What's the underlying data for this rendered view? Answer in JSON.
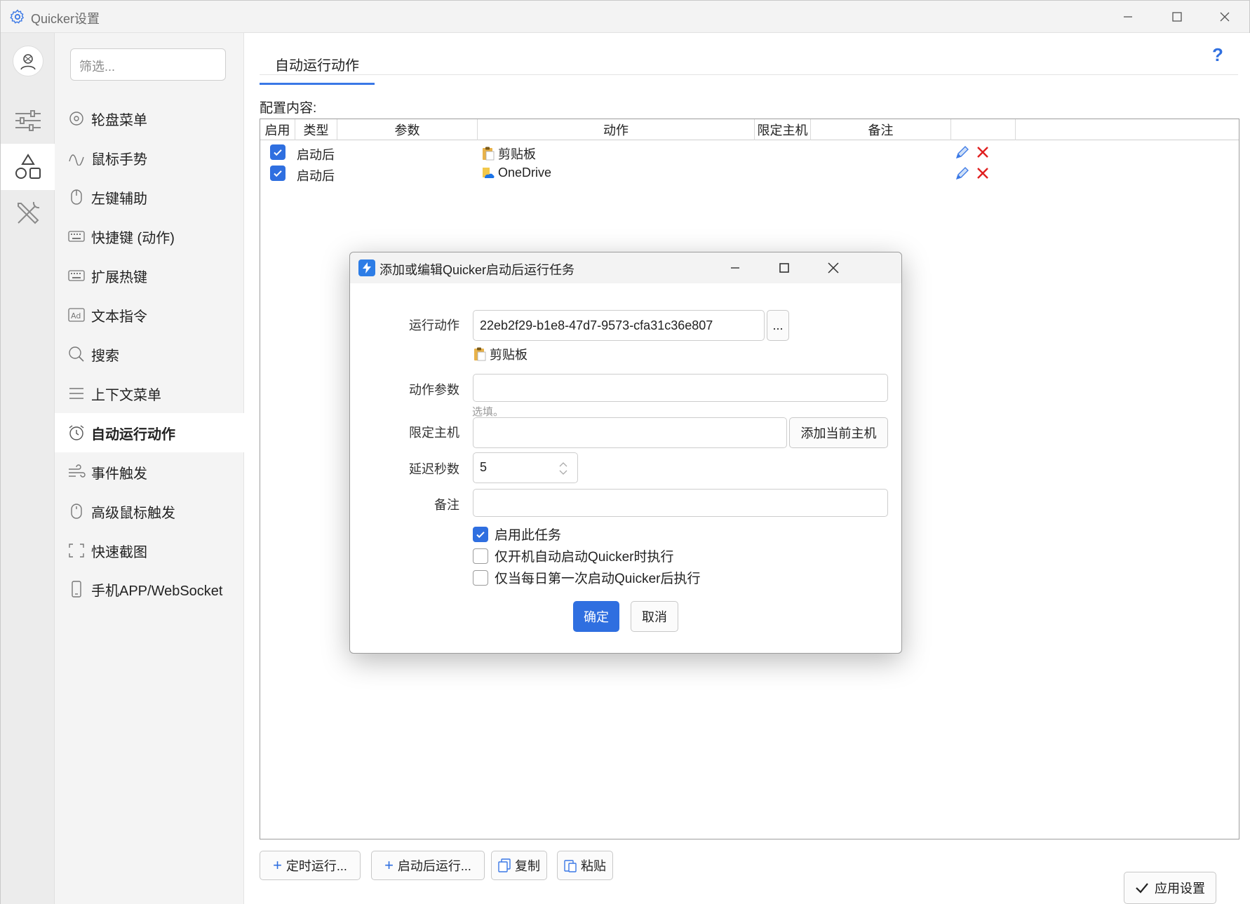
{
  "window": {
    "title": "Quicker设置",
    "controls": [
      "minimize",
      "maximize",
      "close"
    ]
  },
  "rail": {
    "icons": [
      "avatar",
      "sliders-icon",
      "shapes-icon",
      "tools-icon"
    ],
    "active": "shapes-icon"
  },
  "nav": {
    "filter_placeholder": "筛选...",
    "items": [
      {
        "label": "轮盘菜单",
        "icon": "wheel-icon"
      },
      {
        "label": "鼠标手势",
        "icon": "gesture-icon"
      },
      {
        "label": "左键辅助",
        "icon": "mouse-icon"
      },
      {
        "label": "快捷键 (动作)",
        "icon": "keyboard-icon"
      },
      {
        "label": "扩展热键",
        "icon": "keyboard-icon"
      },
      {
        "label": "文本指令",
        "icon": "ad-icon"
      },
      {
        "label": "搜索",
        "icon": "search-icon"
      },
      {
        "label": "上下文菜单",
        "icon": "menu-icon"
      },
      {
        "label": "自动运行动作",
        "icon": "alarm-icon"
      },
      {
        "label": "事件触发",
        "icon": "wind-icon"
      },
      {
        "label": "高级鼠标触发",
        "icon": "mouse-icon"
      },
      {
        "label": "快速截图",
        "icon": "screenshot-icon"
      },
      {
        "label": "手机APP/WebSocket",
        "icon": "phone-icon"
      }
    ],
    "active_index": 8
  },
  "main": {
    "tab": "自动运行动作",
    "help": "?",
    "config_label": "配置内容:",
    "columns": [
      "启用",
      "类型",
      "参数",
      "动作",
      "限定主机",
      "备注"
    ],
    "rows": [
      {
        "enabled": true,
        "type": "启动后",
        "param": "",
        "action": "剪贴板",
        "action_icon": "clipboard-icon",
        "host": "",
        "note": ""
      },
      {
        "enabled": true,
        "type": "启动后",
        "param": "",
        "action": "OneDrive",
        "action_icon": "onedrive-icon",
        "host": "",
        "note": ""
      }
    ],
    "buttons": {
      "timed": "定时运行...",
      "after_start": "启动后运行...",
      "copy": "复制",
      "paste": "粘贴",
      "apply": "应用设置"
    }
  },
  "dialog": {
    "title": "添加或编辑Quicker启动后运行任务",
    "run_action_label": "运行动作",
    "run_action_value": "22eb2f29-b1e8-47d7-9573-cfa31c36e807",
    "browse_label": "...",
    "action_name": "剪贴板",
    "action_params_label": "动作参数",
    "action_params_value": "",
    "optional_hint": "选填。",
    "host_label": "限定主机",
    "host_value": "",
    "add_host_label": "添加当前主机",
    "delay_label": "延迟秒数",
    "delay_value": "5",
    "note_label": "备注",
    "note_value": "",
    "checkboxes": [
      {
        "label": "启用此任务",
        "checked": true
      },
      {
        "label": "仅开机自动启动Quicker时执行",
        "checked": false
      },
      {
        "label": "仅当每日第一次启动Quicker后执行",
        "checked": false
      }
    ],
    "ok_label": "确定",
    "cancel_label": "取消"
  },
  "colors": {
    "accent": "#2f6fe0",
    "delete": "#e02020"
  }
}
